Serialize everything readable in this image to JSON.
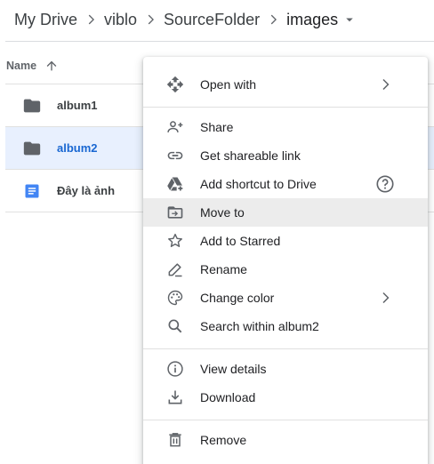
{
  "breadcrumb": {
    "items": [
      "My Drive",
      "viblo",
      "SourceFolder",
      "images"
    ]
  },
  "list": {
    "column_name": "Name",
    "rows": [
      {
        "name": "album1",
        "type": "folder",
        "selected": false
      },
      {
        "name": "album2",
        "type": "folder",
        "selected": true
      },
      {
        "name": "Đây là ảnh",
        "type": "document",
        "selected": false
      }
    ]
  },
  "context_menu": {
    "items": [
      {
        "label": "Open with",
        "icon": "move-arrows-icon",
        "submenu": true
      },
      {
        "label": "Share",
        "icon": "person-add-icon"
      },
      {
        "label": "Get shareable link",
        "icon": "link-icon"
      },
      {
        "label": "Add shortcut to Drive",
        "icon": "drive-shortcut-icon",
        "help": true
      },
      {
        "label": "Move to",
        "icon": "folder-move-icon",
        "highlighted": true
      },
      {
        "label": "Add to Starred",
        "icon": "star-outline-icon"
      },
      {
        "label": "Rename",
        "icon": "pencil-icon"
      },
      {
        "label": "Change color",
        "icon": "palette-icon",
        "submenu": true
      },
      {
        "label": "Search within album2",
        "icon": "search-icon"
      },
      {
        "label": "View details",
        "icon": "info-icon"
      },
      {
        "label": "Download",
        "icon": "download-icon"
      },
      {
        "label": "Remove",
        "icon": "trash-icon"
      }
    ]
  },
  "colors": {
    "selected_row_bg": "#e8f0fe",
    "selected_text": "#1967d2",
    "menu_hover_bg": "#ececec",
    "icon_gray": "#5f6368",
    "doc_blue": "#4285f4"
  }
}
